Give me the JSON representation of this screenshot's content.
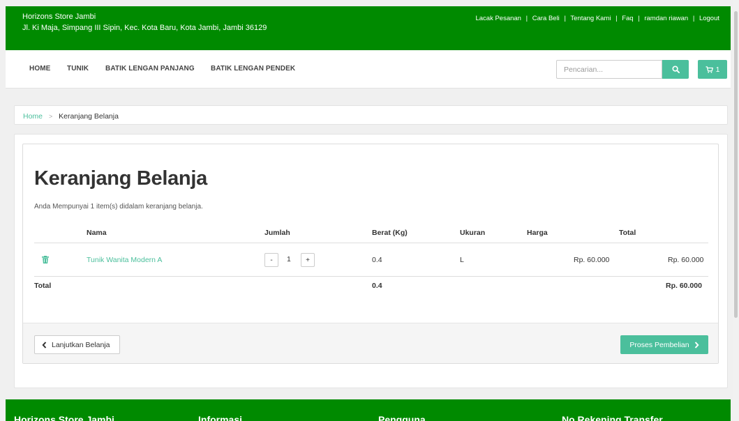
{
  "header": {
    "store_name": "Horizons Store Jambi",
    "store_address": "Jl. Ki Maja, Simpang III Sipin, Kec. Kota Baru, Kota Jambi, Jambi 36129",
    "links": [
      "Lacak Pesanan",
      "Cara Beli",
      "Tentang Kami",
      "Faq",
      "ramdan riawan",
      "Logout"
    ],
    "separator": "|"
  },
  "nav": {
    "items": [
      "HOME",
      "TUNIK",
      "BATIK LENGAN PANJANG",
      "BATIK LENGAN PENDEK"
    ],
    "search_placeholder": "Pencarian...",
    "cart_count": "1"
  },
  "breadcrumb": {
    "home": "Home",
    "separator": ">",
    "current": "Keranjang Belanja"
  },
  "cart": {
    "title": "Keranjang Belanja",
    "info": "Anda Mempunyai 1 item(s) didalam keranjang belanja.",
    "columns": [
      "Nama",
      "Jumlah",
      "Berat (Kg)",
      "Ukuran",
      "Harga",
      "Total"
    ],
    "item": {
      "name": "Tunik Wanita Modern A",
      "minus": "-",
      "qty": "1",
      "plus": "+",
      "weight": "0.4",
      "size": "L",
      "price": "Rp. 60.000",
      "total": "Rp. 60.000"
    },
    "summary": {
      "label": "Total",
      "weight": "0.4",
      "total": "Rp. 60.000"
    },
    "back_label": "Lanjutkan Belanja",
    "proceed_label": "Proses Pembelian"
  },
  "footer": {
    "columns": [
      "Horizons Store Jambi",
      "Informasi",
      "Pengguna",
      "No Rekening Transfer"
    ]
  },
  "colors": {
    "brand_green": "#008a00",
    "accent": "#4bbf9c"
  },
  "icons": {
    "search": "search-icon",
    "cart": "cart-icon",
    "trash": "trash-icon",
    "back": "chevron-left-icon",
    "proceed": "chevron-right-icon"
  }
}
